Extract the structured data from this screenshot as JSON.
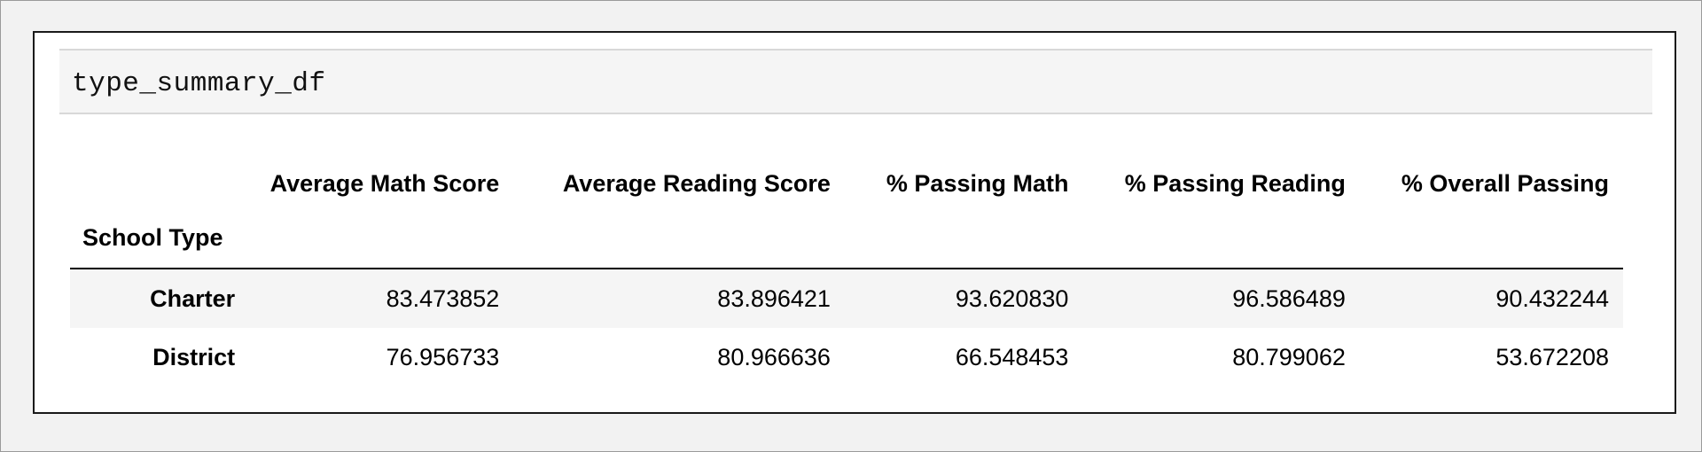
{
  "code_cell": {
    "source": "type_summary_df"
  },
  "dataframe": {
    "columns": [
      "Average Math Score",
      "Average Reading Score",
      "% Passing Math",
      "% Passing Reading",
      "% Overall Passing"
    ],
    "index_name": "School Type",
    "rows": [
      {
        "label": "Charter",
        "values": [
          "83.473852",
          "83.896421",
          "93.620830",
          "96.586489",
          "90.432244"
        ]
      },
      {
        "label": "District",
        "values": [
          "76.956733",
          "80.966636",
          "66.548453",
          "80.799062",
          "53.672208"
        ]
      }
    ]
  },
  "colors": {
    "page_background": "#f2f2f2",
    "panel_background": "#ffffff",
    "code_cell_background": "#f5f5f5",
    "striped_row_background": "#f5f5f5"
  }
}
